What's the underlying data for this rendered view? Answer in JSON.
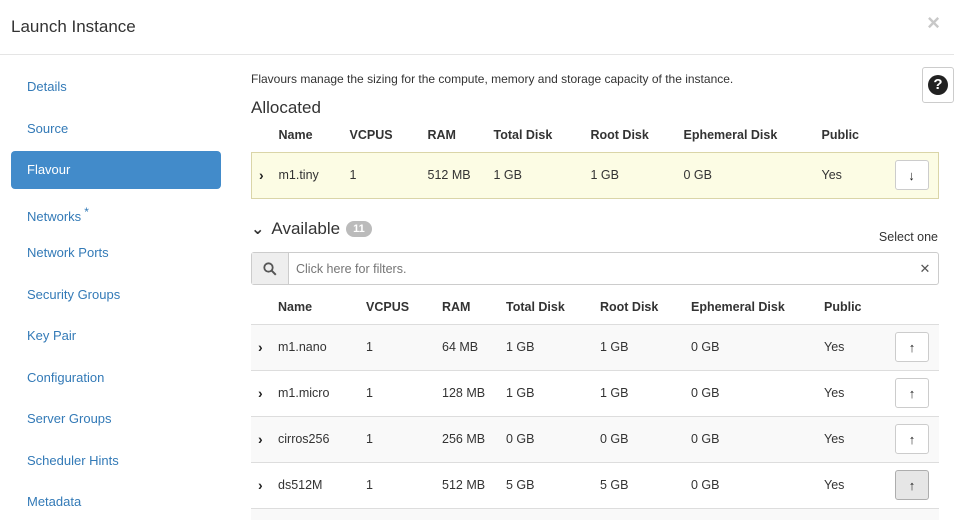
{
  "dialog": {
    "title": "Launch Instance",
    "close_glyph": "×"
  },
  "sidebar": {
    "items": [
      {
        "label": "Details"
      },
      {
        "label": "Source"
      },
      {
        "label": "Flavour",
        "active": true
      },
      {
        "label": "Networks",
        "required_mark": "*"
      },
      {
        "label": "Network Ports"
      },
      {
        "label": "Security Groups"
      },
      {
        "label": "Key Pair"
      },
      {
        "label": "Configuration"
      },
      {
        "label": "Server Groups"
      },
      {
        "label": "Scheduler Hints"
      },
      {
        "label": "Metadata"
      }
    ]
  },
  "help": {
    "glyph": "?"
  },
  "description": "Flavours manage the sizing for the compute, memory and storage capacity of the instance.",
  "allocated": {
    "title": "Allocated",
    "columns": [
      "Name",
      "VCPUS",
      "RAM",
      "Total Disk",
      "Root Disk",
      "Ephemeral Disk",
      "Public"
    ],
    "rows": [
      {
        "name": "m1.tiny",
        "vcpus": "1",
        "ram": "512 MB",
        "total_disk": "1 GB",
        "root_disk": "1 GB",
        "ephemeral_disk": "0 GB",
        "public": "Yes"
      }
    ]
  },
  "available": {
    "title": "Available",
    "count": "11",
    "select_hint": "Select one",
    "filter_placeholder": "Click here for filters.",
    "columns": [
      "Name",
      "VCPUS",
      "RAM",
      "Total Disk",
      "Root Disk",
      "Ephemeral Disk",
      "Public"
    ],
    "rows": [
      {
        "name": "m1.nano",
        "vcpus": "1",
        "ram": "64 MB",
        "total_disk": "1 GB",
        "root_disk": "1 GB",
        "ephemeral_disk": "0 GB",
        "public": "Yes"
      },
      {
        "name": "m1.micro",
        "vcpus": "1",
        "ram": "128 MB",
        "total_disk": "1 GB",
        "root_disk": "1 GB",
        "ephemeral_disk": "0 GB",
        "public": "Yes"
      },
      {
        "name": "cirros256",
        "vcpus": "1",
        "ram": "256 MB",
        "total_disk": "0 GB",
        "root_disk": "0 GB",
        "ephemeral_disk": "0 GB",
        "public": "Yes"
      },
      {
        "name": "ds512M",
        "vcpus": "1",
        "ram": "512 MB",
        "total_disk": "5 GB",
        "root_disk": "5 GB",
        "ephemeral_disk": "0 GB",
        "public": "Yes"
      }
    ]
  },
  "colors": {
    "accent": "#428bca",
    "link": "#337ab7",
    "allocated_bg": "#fcfce4"
  },
  "icons": {
    "expand": "chevron-right-icon",
    "allocate": "arrow-up-icon",
    "deallocate": "arrow-down-icon",
    "search": "search-icon",
    "clear": "clear-icon"
  }
}
